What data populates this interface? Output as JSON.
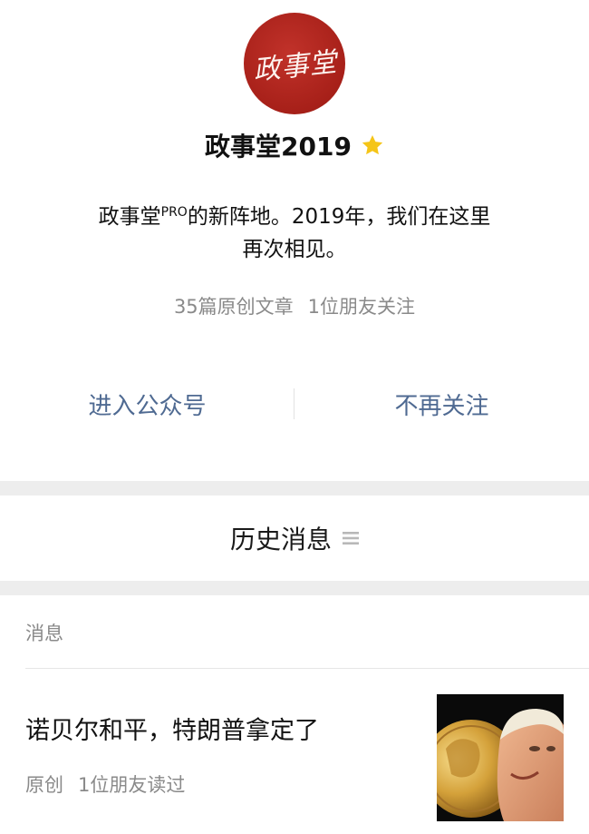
{
  "account": {
    "logo_text": "政事堂",
    "name": "政事堂2019",
    "desc_part1": "政事堂",
    "desc_sup": "PRO",
    "desc_part2": "的新阵地。2019年，我们在这里",
    "desc_line2": "再次相见。",
    "original_articles": "35篇原创文章",
    "friends_following": "1位朋友关注"
  },
  "actions": {
    "enter": "进入公众号",
    "unfollow": "不再关注"
  },
  "history": {
    "title": "历史消息",
    "section_label": "消息"
  },
  "article": {
    "title": "诺贝尔和平，特朗普拿定了",
    "tag": "原创",
    "reads": "1位朋友读过"
  },
  "colors": {
    "accent_link": "#4f6a92",
    "star": "#f5c518",
    "logo_red": "#a72019"
  },
  "icons": {
    "star": "star-icon",
    "list": "list-icon"
  }
}
